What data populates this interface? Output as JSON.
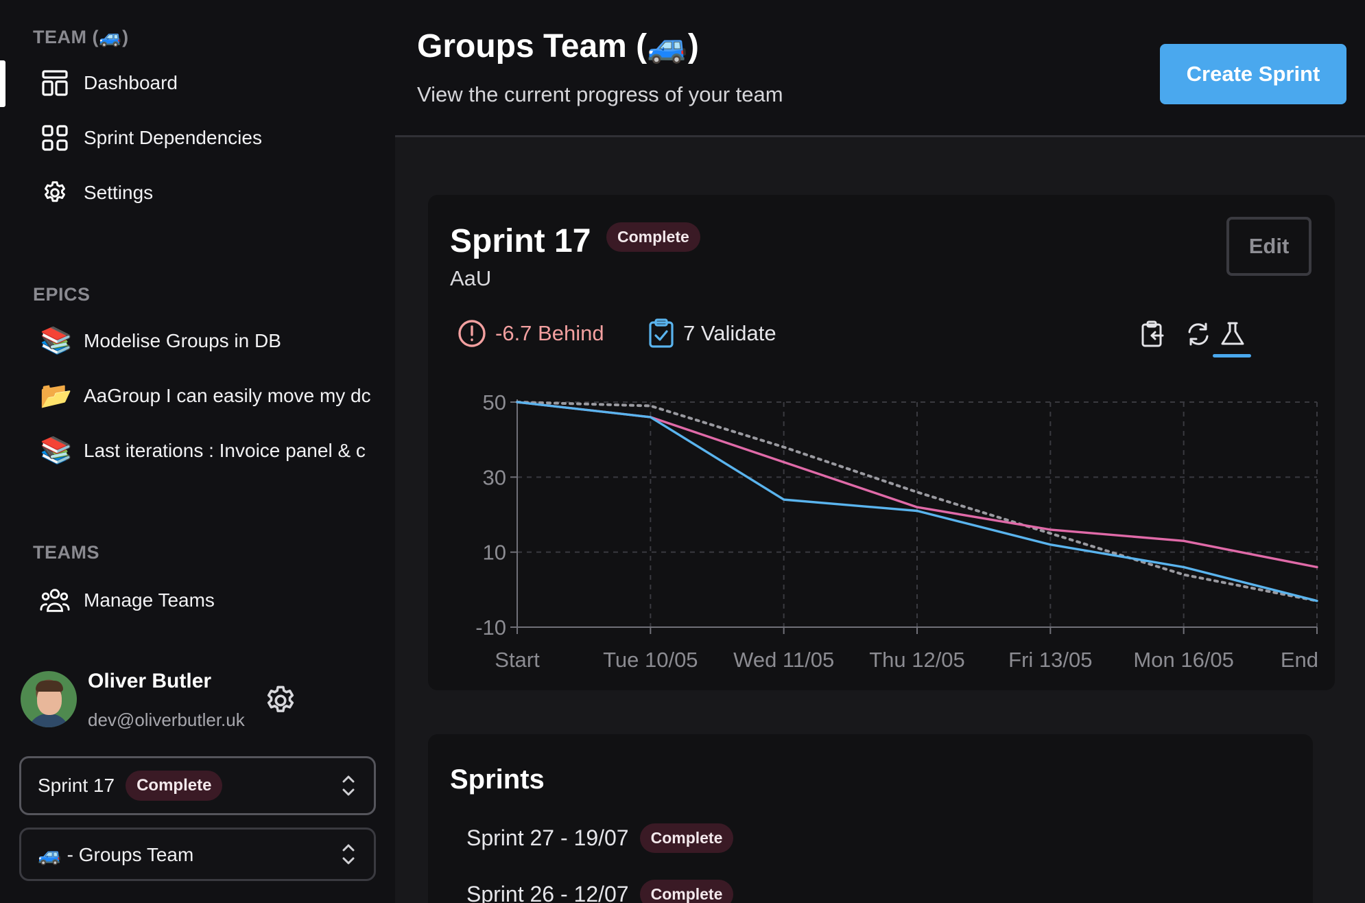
{
  "sidebar": {
    "team_section": "TEAM (🚙)",
    "nav": [
      {
        "label": "Dashboard",
        "icon": "layout-icon"
      },
      {
        "label": "Sprint Dependencies",
        "icon": "grid-icon"
      },
      {
        "label": "Settings",
        "icon": "gear-icon"
      }
    ],
    "epics_section": "EPICS",
    "epics": [
      {
        "label": "Modelise Groups in DB",
        "icon": "📚"
      },
      {
        "label": "AaGroup I can easily move my dc",
        "icon": "📂"
      },
      {
        "label": "Last iterations : Invoice panel & c",
        "icon": "📚"
      }
    ],
    "teams_section": "TEAMS",
    "teams": [
      {
        "label": "Manage Teams",
        "icon": "users-icon"
      }
    ],
    "profile": {
      "name": "Oliver Butler",
      "email": "dev@oliverbutler.uk"
    },
    "sprint_select": {
      "value": "Sprint 17",
      "badge": "Complete"
    },
    "team_select": {
      "value": "🚙 - Groups Team"
    }
  },
  "header": {
    "title": "Groups Team (🚙)",
    "subtitle": "View the current progress of your team",
    "create_button": "Create Sprint"
  },
  "sprint": {
    "title": "Sprint 17",
    "badge": "Complete",
    "subtitle": "AaU",
    "edit_button": "Edit",
    "behind": "-6.7 Behind",
    "validate": "7 Validate"
  },
  "sprints_list": {
    "title": "Sprints",
    "rows": [
      {
        "label": "Sprint 27 - 19/07",
        "badge": "Complete"
      },
      {
        "label": "Sprint 26 - 12/07",
        "badge": "Complete"
      }
    ]
  },
  "colors": {
    "accent": "#4aa8ee",
    "pink_series": "#e06aa8",
    "blue_series": "#5ab4ee",
    "ideal_series": "#9a9aa0",
    "badge_bg": "#3a1a25"
  },
  "chart_data": {
    "type": "line",
    "categories": [
      "Start",
      "Tue 10/05",
      "Wed 11/05",
      "Thu 12/05",
      "Fri 13/05",
      "Mon 16/05",
      "End"
    ],
    "yticks": [
      50,
      30,
      10,
      -10
    ],
    "ylim": [
      -10,
      50
    ],
    "grid": true,
    "series": [
      {
        "name": "",
        "style": "dotted",
        "color": "#9a9aa0",
        "values": [
          50,
          49,
          38,
          26,
          15,
          4,
          -3
        ]
      },
      {
        "name": "",
        "style": "solid",
        "color": "#e06aa8",
        "values": [
          50,
          46,
          34,
          22,
          16,
          13,
          6
        ]
      },
      {
        "name": "",
        "style": "solid",
        "color": "#5ab4ee",
        "values": [
          50,
          46,
          24,
          21,
          12,
          6,
          -3
        ]
      }
    ]
  }
}
